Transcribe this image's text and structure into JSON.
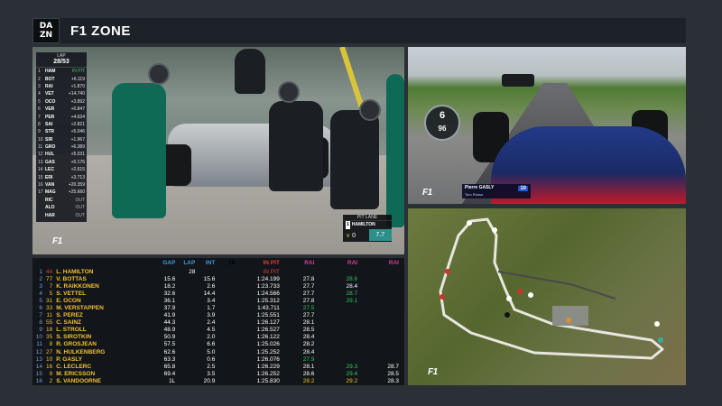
{
  "header": {
    "logo_top": "DA",
    "logo_bottom": "ZN",
    "title": "F1 ZONE"
  },
  "pit_panel": {
    "tower_lap_label": "LAP",
    "tower_lap_value": "28/53",
    "tower": [
      {
        "pos": "1",
        "code": "HAM",
        "gap": "IN PIT"
      },
      {
        "pos": "2",
        "code": "BOT",
        "gap": "+6.119"
      },
      {
        "pos": "3",
        "code": "RAI",
        "gap": "+1.870"
      },
      {
        "pos": "4",
        "code": "VET",
        "gap": "+14.740"
      },
      {
        "pos": "5",
        "code": "OCO",
        "gap": "+3.892"
      },
      {
        "pos": "6",
        "code": "VER",
        "gap": "+0.847"
      },
      {
        "pos": "7",
        "code": "PER",
        "gap": "+4.634"
      },
      {
        "pos": "8",
        "code": "SAI",
        "gap": "+2.821"
      },
      {
        "pos": "9",
        "code": "STR",
        "gap": "+5.046"
      },
      {
        "pos": "10",
        "code": "SIR",
        "gap": "+1.967"
      },
      {
        "pos": "11",
        "code": "GRO",
        "gap": "+6.389"
      },
      {
        "pos": "12",
        "code": "HUL",
        "gap": "+5.031"
      },
      {
        "pos": "13",
        "code": "GAS",
        "gap": "+0.176"
      },
      {
        "pos": "14",
        "code": "LEC",
        "gap": "+2.615"
      },
      {
        "pos": "15",
        "code": "ERI",
        "gap": "+3.713"
      },
      {
        "pos": "16",
        "code": "VAN",
        "gap": "+20.359"
      },
      {
        "pos": "17",
        "code": "MAG",
        "gap": "+25.660"
      },
      {
        "pos": "",
        "code": "RIC",
        "gap": "OUT"
      },
      {
        "pos": "",
        "code": "ALO",
        "gap": "OUT"
      },
      {
        "pos": "",
        "code": "HAR",
        "gap": "OUT"
      }
    ],
    "pit_lane": {
      "title": "PIT LANE",
      "driver_num": "1",
      "driver": "HAMILTON",
      "stat_a": "0",
      "stat_b": "7.7"
    },
    "brand": "F1"
  },
  "onboard_panel": {
    "gear": "6",
    "speed": "96",
    "driver": "Pierre GASLY",
    "team": "Toro Rosso",
    "number": "10",
    "brand": "F1"
  },
  "map_panel": {
    "brand": "F1"
  },
  "timing": {
    "headers": {
      "gap": "GAP",
      "lap": "LAP",
      "int": "INT",
      "time": "28",
      "s1_pit": "IN PIT",
      "s1": "RAI",
      "s2": "RAI",
      "s3": "RAI"
    },
    "rows": [
      {
        "pos": "1",
        "num": "44",
        "name": "L.  HAMILTON",
        "gap": "",
        "int": "",
        "lap": "28",
        "time": "IN PIT",
        "s1": "",
        "s2": "",
        "s3": "",
        "num_red": true,
        "time_red": true
      },
      {
        "pos": "2",
        "num": "77",
        "name": "V.  BOTTAS",
        "gap": "15.6",
        "int": "15.6",
        "lap": "",
        "time": "1:24.199",
        "s1": "27.8",
        "s2": "28.6",
        "s3": "",
        "s2c": "green"
      },
      {
        "pos": "3",
        "num": "7",
        "name": "K.  RAIKKONEN",
        "gap": "18.2",
        "int": "2.6",
        "lap": "",
        "time": "1:23.733",
        "s1": "27.7",
        "s2": "28.4",
        "s3": ""
      },
      {
        "pos": "4",
        "num": "5",
        "name": "S.  VETTEL",
        "gap": "32.6",
        "int": "14.4",
        "lap": "",
        "time": "1:24.566",
        "s1": "27.7",
        "s2": "28.7",
        "s3": "",
        "s2c": "green"
      },
      {
        "pos": "5",
        "num": "31",
        "name": "E.  OCON",
        "gap": "36.1",
        "int": "3.4",
        "lap": "",
        "time": "1:25.312",
        "s1": "27.8",
        "s2": "29.1",
        "s3": "",
        "s2c": "green"
      },
      {
        "pos": "6",
        "num": "33",
        "name": "M.  VERSTAPPEN",
        "gap": "37.9",
        "int": "1.7",
        "lap": "",
        "time": "1:43.711",
        "s1": "27.5",
        "s2": "",
        "s3": "",
        "s1c": "green"
      },
      {
        "pos": "7",
        "num": "11",
        "name": "S.  PEREZ",
        "gap": "41.9",
        "int": "3.9",
        "lap": "",
        "time": "1:25.551",
        "s1": "27.7",
        "s2": "",
        "s3": ""
      },
      {
        "pos": "8",
        "num": "55",
        "name": "C.  SAINZ",
        "gap": "44.3",
        "int": "2.4",
        "lap": "",
        "time": "1:26.127",
        "s1": "28.1",
        "s2": "",
        "s3": ""
      },
      {
        "pos": "9",
        "num": "18",
        "name": "L.  STROLL",
        "gap": "48.9",
        "int": "4.5",
        "lap": "",
        "time": "1:26.527",
        "s1": "28.5",
        "s2": "",
        "s3": ""
      },
      {
        "pos": "10",
        "num": "35",
        "name": "S.  SIROTKIN",
        "gap": "50.9",
        "int": "2.0",
        "lap": "",
        "time": "1:26.122",
        "s1": "28.4",
        "s2": "",
        "s3": ""
      },
      {
        "pos": "11",
        "num": "8",
        "name": "R.  GROSJEAN",
        "gap": "57.5",
        "int": "6.6",
        "lap": "",
        "time": "1:25.026",
        "s1": "28.2",
        "s2": "",
        "s3": ""
      },
      {
        "pos": "12",
        "num": "27",
        "name": "N.  HULKENBERG",
        "gap": "62.6",
        "int": "5.0",
        "lap": "",
        "time": "1:25.252",
        "s1": "28.4",
        "s2": "",
        "s3": ""
      },
      {
        "pos": "13",
        "num": "10",
        "name": "P.  GASLY",
        "gap": "63.3",
        "int": "0.6",
        "lap": "",
        "time": "1:26.076",
        "s1": "27.9",
        "s2": "",
        "s3": "",
        "s1c": "green"
      },
      {
        "pos": "14",
        "num": "16",
        "name": "C.  LECLERC",
        "gap": "65.8",
        "int": "2.5",
        "lap": "",
        "time": "1:26.229",
        "s1": "28.1",
        "s2": "29.3",
        "s3": "28.7",
        "s2c": "green"
      },
      {
        "pos": "15",
        "num": "9",
        "name": "M.  ERICSSON",
        "gap": "69.4",
        "int": "3.5",
        "lap": "",
        "time": "1:26.252",
        "s1": "28.6",
        "s2": "29.4",
        "s3": "28.5",
        "s2c": "green"
      },
      {
        "pos": "16",
        "num": "2",
        "name": "S.  VANDOORNE",
        "gap": "1L",
        "int": "20.9",
        "lap": "",
        "time": "1:25.830",
        "s1": "28.2",
        "s2": "29.2",
        "s3": "28.3",
        "s1c": "yellow",
        "s2c": "yellow",
        "s3c": ""
      }
    ]
  },
  "colors": {
    "background": "#2b3036",
    "header_bar": "#1d2228",
    "timing_name": "#f2c230",
    "timing_header_blue": "#3a9bd8",
    "timing_header_pink": "#d73aa2",
    "personal_best": "#33c75a"
  }
}
